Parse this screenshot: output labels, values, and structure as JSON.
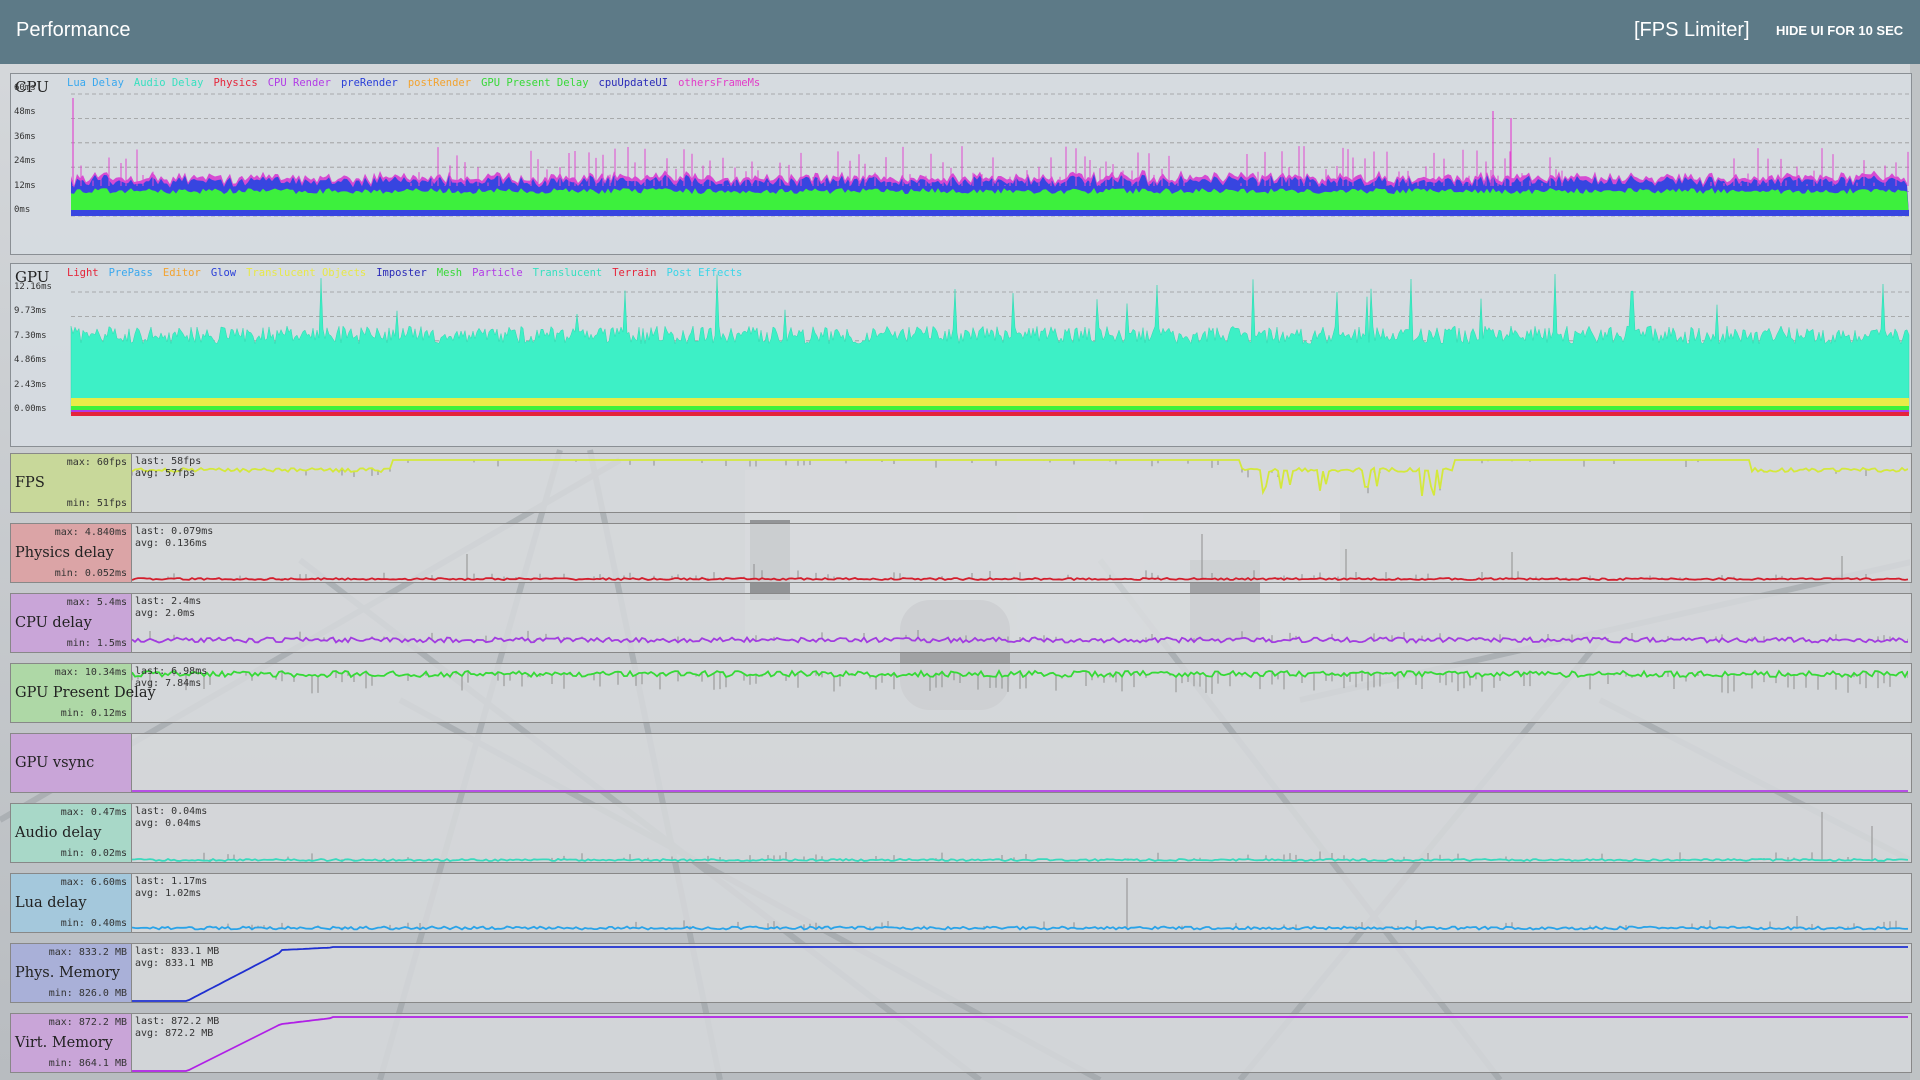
{
  "header": {
    "title": "Performance",
    "fps_limiter": "[FPS Limiter]",
    "hide_ui": "HIDE UI FOR 10 SEC"
  },
  "cpu_panel": {
    "title": "CPU",
    "y_ticks": [
      "60ms",
      "48ms",
      "36ms",
      "24ms",
      "12ms",
      "0ms"
    ],
    "legend": [
      {
        "label": "Lua Delay",
        "color": "#3aa8ee"
      },
      {
        "label": "Audio Delay",
        "color": "#39e0c0"
      },
      {
        "label": "Physics",
        "color": "#e5253a"
      },
      {
        "label": "CPU Render",
        "color": "#b23ce6"
      },
      {
        "label": "preRender",
        "color": "#2a3fd8"
      },
      {
        "label": "postRender",
        "color": "#f2a330"
      },
      {
        "label": "GPU Present Delay",
        "color": "#37d937"
      },
      {
        "label": "cpuUpdateUI",
        "color": "#2a2ab8"
      },
      {
        "label": "othersFrameMs",
        "color": "#e23cc8"
      }
    ]
  },
  "gpu_panel": {
    "title": "GPU",
    "y_ticks": [
      "12.16ms",
      "9.73ms",
      "7.30ms",
      "4.86ms",
      "2.43ms",
      "0.00ms"
    ],
    "legend": [
      {
        "label": "Light",
        "color": "#e5253a"
      },
      {
        "label": "PrePass",
        "color": "#3aa8ee"
      },
      {
        "label": "Editor",
        "color": "#f2a330"
      },
      {
        "label": "Glow",
        "color": "#2a3fd8"
      },
      {
        "label": "Translucent Objects",
        "color": "#e8e848"
      },
      {
        "label": "Imposter",
        "color": "#2a2ab8"
      },
      {
        "label": "Mesh",
        "color": "#37d937"
      },
      {
        "label": "Particle",
        "color": "#b23ce6"
      },
      {
        "label": "Translucent",
        "color": "#39e0c0"
      },
      {
        "label": "Terrain",
        "color": "#e5253a"
      },
      {
        "label": "Post Effects",
        "color": "#39d6e8"
      }
    ]
  },
  "strips": [
    {
      "name": "FPS",
      "max": "max: 60fps",
      "min": "min: 51fps",
      "last": "last: 58fps",
      "avg": "avg: 57fps",
      "color": "#d4e83c",
      "label_bg": "#c8d89a"
    },
    {
      "name": "Physics delay",
      "max": "max: 4.840ms",
      "min": "min: 0.052ms",
      "last": "last: 0.079ms",
      "avg": "avg: 0.136ms",
      "color": "#d41e2c",
      "label_bg": "#dba4a6"
    },
    {
      "name": "CPU delay",
      "max": "max: 5.4ms",
      "min": "min: 1.5ms",
      "last": "last: 2.4ms",
      "avg": "avg: 2.0ms",
      "color": "#a23ce0",
      "label_bg": "#c9a5d8"
    },
    {
      "name": "GPU Present Delay",
      "max": "max: 10.34ms",
      "min": "min: 0.12ms",
      "last": "last: 6.98ms",
      "avg": "avg: 7.84ms",
      "color": "#36d936",
      "label_bg": "#aed8a6"
    },
    {
      "name": "GPU vsync",
      "max": "",
      "min": "",
      "last": "",
      "avg": "",
      "color": "#b23ce6",
      "label_bg": "#c9a5d8"
    },
    {
      "name": "Audio delay",
      "max": "max: 0.47ms",
      "min": "min: 0.02ms",
      "last": "last: 0.04ms",
      "avg": "avg: 0.04ms",
      "color": "#39d9bd",
      "label_bg": "#a8d8c8"
    },
    {
      "name": "Lua delay",
      "max": "max: 6.60ms",
      "min": "min: 0.40ms",
      "last": "last: 1.17ms",
      "avg": "avg: 1.02ms",
      "color": "#2aa3e8",
      "label_bg": "#a4c8dc"
    },
    {
      "name": "Phys. Memory",
      "max": "max: 833.2 MB",
      "min": "min: 826.0 MB",
      "last": "last: 833.1 MB",
      "avg": "avg: 833.1 MB",
      "color": "#1f2fd0",
      "label_bg": "#a9b0d8"
    },
    {
      "name": "Virt. Memory",
      "max": "max: 872.2 MB",
      "min": "min: 864.1 MB",
      "last": "last: 872.2 MB",
      "avg": "avg: 872.2 MB",
      "color": "#b020e6",
      "label_bg": "#c9a5d8"
    }
  ]
}
